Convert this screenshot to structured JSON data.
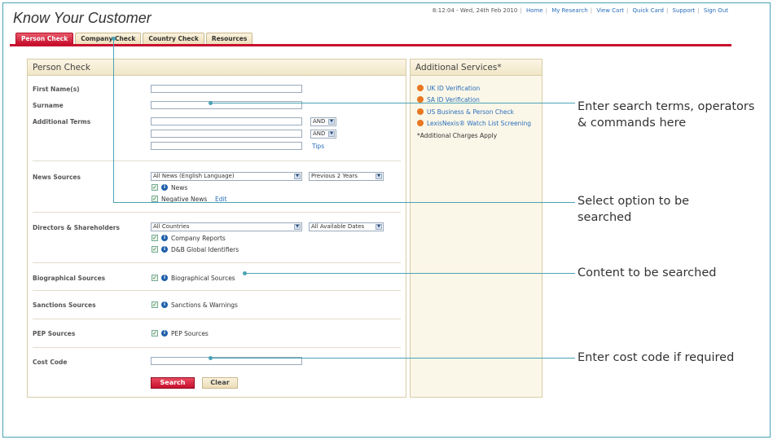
{
  "app": {
    "title": "Know Your Customer",
    "status": "8:12:04 - Wed, 24th Feb 2010",
    "links": [
      "Home",
      "My Research",
      "View Cart",
      "Quick Card",
      "Support",
      "Sign Out"
    ]
  },
  "tabs": [
    {
      "label": "Person Check",
      "active": true
    },
    {
      "label": "Company Check",
      "active": false
    },
    {
      "label": "Country Check",
      "active": false
    },
    {
      "label": "Resources",
      "active": false
    }
  ],
  "form": {
    "title": "Person Check",
    "first_name_label": "First Name(s)",
    "surname_label": "Surname",
    "additional_terms_label": "Additional Terms",
    "operator1": "AND",
    "operator2": "AND",
    "tips_link": "Tips",
    "news_sources_label": "News Sources",
    "news_select": "All News (English Language)",
    "news_period": "Previous 2 Years",
    "news_option": "News",
    "negative_news_option": "Negative News",
    "edit_link": "Edit",
    "directors_label": "Directors & Shareholders",
    "countries_select": "All Countries",
    "dates_select": "All Available Dates",
    "company_reports_option": "Company Reports",
    "dnb_option": "D&B Global Identifiers",
    "biographical_label": "Biographical Sources",
    "biographical_option": "Biographical Sources",
    "sanctions_label": "Sanctions Sources",
    "sanctions_option": "Sanctions & Warnings",
    "pep_label": "PEP Sources",
    "pep_option": "PEP Sources",
    "cost_code_label": "Cost Code",
    "search_button": "Search",
    "clear_button": "Clear"
  },
  "services": {
    "title": "Additional Services*",
    "items": [
      "UK ID Verification",
      "SA ID Verification",
      "US Business & Person Check",
      "LexisNexis® Watch List Screening"
    ],
    "note": "*Additional Charges Apply"
  },
  "callouts": {
    "c1_line1": "Enter search terms, operators",
    "c1_line2": "& commands here",
    "c2_line1": "Select option to be",
    "c2_line2": "searched",
    "c3": "Content to be searched",
    "c4": "Enter cost code if required"
  },
  "colors": {
    "accent": "#c8102e",
    "callout_line": "#4aa3b5",
    "link": "#2a6ebb"
  }
}
